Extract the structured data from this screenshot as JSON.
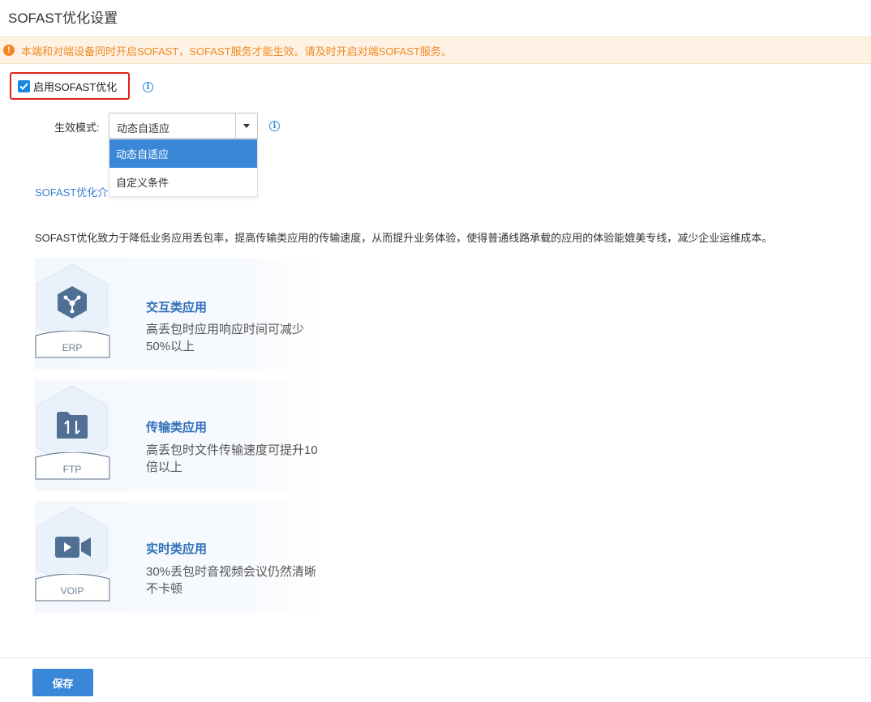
{
  "page": {
    "title": "SOFAST优化设置"
  },
  "alert": {
    "text": "本端和对端设备同时开启SOFAST，SOFAST服务才能生效。请及时开启对端SOFAST服务。",
    "color": "#f08a24"
  },
  "enable": {
    "label": "启用SOFAST优化",
    "checked": true
  },
  "mode": {
    "label": "生效模式:",
    "selected": "动态自适应",
    "options": [
      "动态自适应",
      "自定义条件"
    ]
  },
  "section": {
    "link_text": "SOFAST优化介",
    "description": "SOFAST优化致力于降低业务应用丢包率，提高传输类应用的传输速度，从而提升业务体验，使得普通线路承载的应用的体验能媲美专线，减少企业运维成本。"
  },
  "cards": [
    {
      "icon": "cube-icon",
      "tag": "ERP",
      "title": "交互类应用",
      "desc": "高丢包时应用响应时间可减少50%以上"
    },
    {
      "icon": "transfer-folder-icon",
      "tag": "FTP",
      "title": "传输类应用",
      "desc": "高丢包时文件传输速度可提升10倍以上"
    },
    {
      "icon": "video-camera-icon",
      "tag": "VOIP",
      "title": "实时类应用",
      "desc": "30%丢包时音视频会议仍然清晰不卡顿"
    }
  ],
  "actions": {
    "save_label": "保存"
  },
  "colors": {
    "primary": "#3a87d8",
    "highlight_border": "#e0231d",
    "alert_bg": "#fdf2e4"
  }
}
